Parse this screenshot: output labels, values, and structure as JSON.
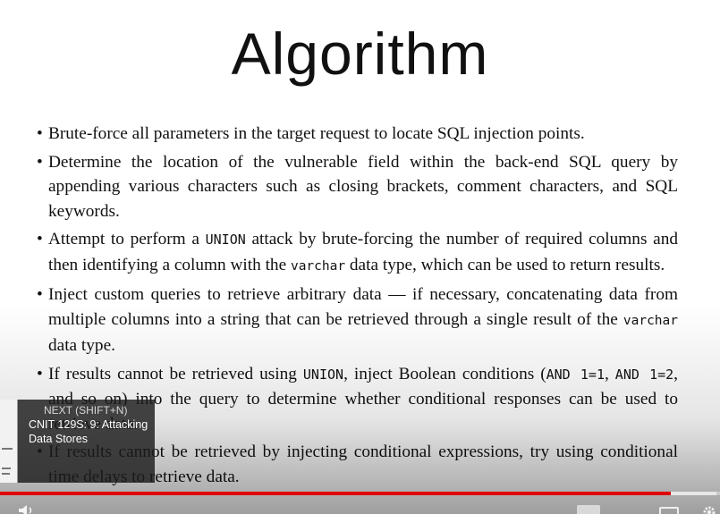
{
  "slide": {
    "title": "Algorithm",
    "bullets": [
      {
        "parts": [
          {
            "t": "Brute-force all parameters in the target request to locate SQL injection points."
          }
        ]
      },
      {
        "parts": [
          {
            "t": "Determine the location of the vulnerable field within the back-end SQL query by appending various characters such as closing brackets, comment characters, and SQL keywords."
          }
        ]
      },
      {
        "parts": [
          {
            "t": "Attempt to perform a "
          },
          {
            "t": "UNION",
            "style": "sc"
          },
          {
            "t": " attack by brute-forcing the number of required columns and then identifying a column with the "
          },
          {
            "t": "varchar",
            "style": "code"
          },
          {
            "t": " data type, which can be used to return results."
          }
        ]
      },
      {
        "parts": [
          {
            "t": "Inject custom queries to retrieve arbitrary data — if necessary, concatenating data from multiple columns into a string that can be retrieved through a single result of the "
          },
          {
            "t": "varchar",
            "style": "code"
          },
          {
            "t": " data type."
          }
        ]
      },
      {
        "parts": [
          {
            "t": "If results cannot be retrieved using "
          },
          {
            "t": "UNION",
            "style": "sc"
          },
          {
            "t": ", inject Boolean conditions ("
          },
          {
            "t": "AND 1=1",
            "style": "sc"
          },
          {
            "t": ", "
          },
          {
            "t": "AND 1=2",
            "style": "sc"
          },
          {
            "t": ", and so on) into the query to determine whether conditional responses can be used to retrieve data."
          }
        ]
      },
      {
        "parts": [
          {
            "t": "If results cannot be retrieved by injecting conditional expressions, try using conditional time delays to retrieve data."
          }
        ]
      }
    ]
  },
  "player": {
    "next_label": "NEXT (SHIFT+N)",
    "next_title": "CNIT 129S: 9: Attacking Data Stores",
    "progress_fraction": 0.932,
    "buffer_fraction": 0.995,
    "time_text": "",
    "icons": [
      "volume-icon",
      "captions-icon",
      "gear-icon"
    ],
    "colors": {
      "progress": "#e00000",
      "overlay": "#1c1c1c"
    }
  }
}
